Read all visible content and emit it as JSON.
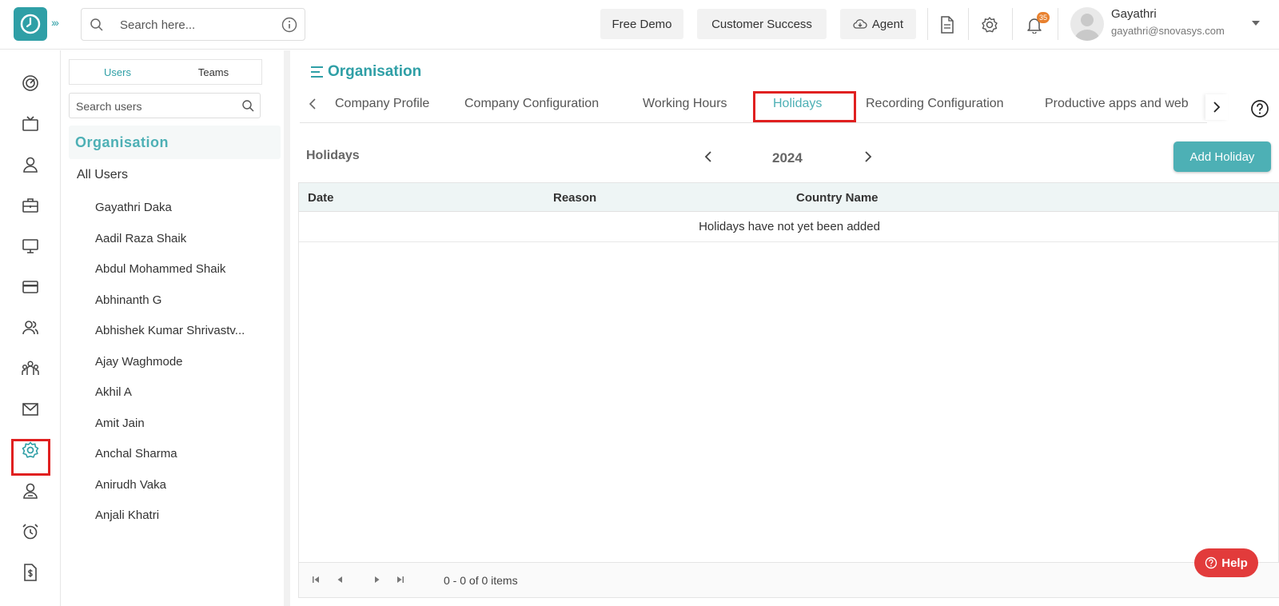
{
  "header": {
    "search_placeholder": "Search here...",
    "buttons": {
      "free_demo": "Free Demo",
      "customer_success": "Customer Success",
      "agent": "Agent"
    },
    "notification_count": "35",
    "user": {
      "name": "Gayathri",
      "email": "gayathri@snovasys.com"
    }
  },
  "rail": {
    "icons": [
      "dashboard-icon",
      "tv-icon",
      "user-icon",
      "briefcase-icon",
      "monitor-icon",
      "card-icon",
      "users-icon",
      "team-icon",
      "mail-icon",
      "settings-icon",
      "person-badge-icon",
      "alarm-icon",
      "invoice-icon"
    ],
    "active": "settings-icon",
    "accent": "#2f9fa6"
  },
  "users_panel": {
    "tabs": [
      "Users",
      "Teams"
    ],
    "active_tab": "Users",
    "search_placeholder": "Search users",
    "org_title": "Organisation",
    "all_users": "All Users",
    "users": [
      "Gayathri Daka",
      "Aadil Raza Shaik",
      "Abdul Mohammed Shaik",
      "Abhinanth G",
      "Abhishek Kumar Shrivastv...",
      "Ajay Waghmode",
      "Akhil A",
      "Amit Jain",
      "Anchal Sharma",
      "Anirudh Vaka",
      "Anjali Khatri"
    ]
  },
  "main": {
    "title": "Organisation",
    "tabs": [
      "Company Profile",
      "Company Configuration",
      "Working Hours",
      "Holidays",
      "Recording Configuration",
      "Productive apps and web"
    ],
    "active_tab": "Holidays",
    "section_title": "Holidays",
    "year": "2024",
    "add_button": "Add Holiday",
    "table": {
      "columns": [
        "Date",
        "Reason",
        "Country Name"
      ],
      "empty_message": "Holidays have not yet been added",
      "pager_text": "0 - 0 of 0 items"
    },
    "help_button": "Help"
  },
  "colors": {
    "brand": "#2f9fa6",
    "highlight": "#e02020",
    "help": "#e23b3b"
  }
}
